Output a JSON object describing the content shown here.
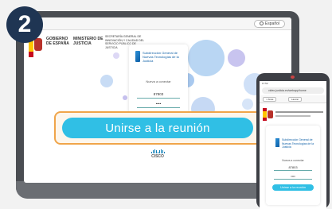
{
  "step": {
    "number": "2"
  },
  "laptop": {
    "language_label": "Español",
    "government": {
      "gov_label": "GOBIERNO DE ESPAÑA",
      "ministry_label": "MINISTERIO DE JUSTICIA",
      "secretariat_label": "SECRETARÍA GENERAL DE INNOVACIÓN Y CALIDAD DEL SERVICIO PÚBLICO DE JUSTICIA"
    },
    "login": {
      "org_name": "Subdirección General de Nuevas Tecnologías de la Justicia",
      "prompt": "Nueva a conectar",
      "meeting_id_value": "87803",
      "password_value": "••••"
    },
    "join_button_label": "Unirse a la reunión",
    "cisco_label": "CISCO"
  },
  "phone": {
    "status_time": "17:52",
    "url": "video.justicia.es/webapp/home",
    "nav_back_label": "< Atrás",
    "nav_action_label": "Lanzar",
    "login": {
      "org_name": "Subdirección General de Nuevas Tecnologías de la Justicia",
      "prompt": "Nueva a conectar",
      "meeting_id_value": "87803",
      "password_value": "••••",
      "join_button_label": "Unirse a la reunión"
    }
  },
  "colors": {
    "badge": "#1f3553",
    "join_button": "#30bfe5",
    "highlight_border": "#f0a54a"
  }
}
